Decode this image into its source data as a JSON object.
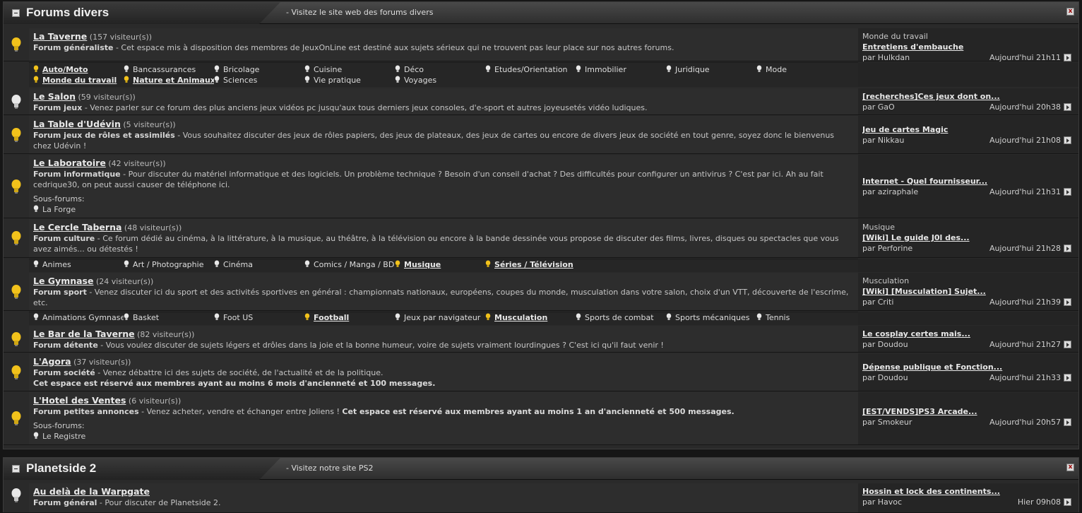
{
  "colors": {
    "bulb_on": "#f2c21b",
    "bulb_off": "#e8e8e8",
    "bg": "#2a2a2a"
  },
  "icons": {
    "bulb": "lightbulb-icon",
    "collapse": "minus-box-icon",
    "close": "close-box-icon",
    "goto": "arrow-right-box-icon"
  },
  "sections": [
    {
      "title": "Forums divers",
      "link": "- Visitez le site web des forums divers",
      "close": "x",
      "forums": [
        {
          "name": "La Taverne",
          "visitors": "(157 visiteur(s))",
          "type": "Forum généraliste",
          "desc": "- Cet espace mis à disposition des membres de JeuxOnLine est destiné aux sujets sérieux qui ne trouvent pas leur place sur nos autres forums.",
          "bold_note": "",
          "lit": true,
          "last": {
            "category": "Monde du travail",
            "topic": "Entretiens d'embauche",
            "by": "par Hulkdan",
            "time": "Aujourd'hui 21h11"
          },
          "subforums": [
            {
              "label": "Auto/Moto",
              "lit": true,
              "bold": true
            },
            {
              "label": "Bancassurances",
              "lit": false,
              "bold": false
            },
            {
              "label": "Bricolage",
              "lit": false,
              "bold": false
            },
            {
              "label": "Cuisine",
              "lit": false,
              "bold": false
            },
            {
              "label": "Déco",
              "lit": false,
              "bold": false
            },
            {
              "label": "Etudes/Orientation",
              "lit": false,
              "bold": false
            },
            {
              "label": "Immobilier",
              "lit": false,
              "bold": false
            },
            {
              "label": "Juridique",
              "lit": false,
              "bold": false
            },
            {
              "label": "Mode",
              "lit": false,
              "bold": false
            },
            {
              "label": "Monde du travail",
              "lit": true,
              "bold": true
            },
            {
              "label": "Nature et Animaux",
              "lit": true,
              "bold": true
            },
            {
              "label": "Sciences",
              "lit": false,
              "bold": false
            },
            {
              "label": "Vie pratique",
              "lit": false,
              "bold": false
            },
            {
              "label": "Voyages",
              "lit": false,
              "bold": false
            }
          ]
        },
        {
          "name": "Le Salon",
          "visitors": "(59 visiteur(s))",
          "type": "Forum jeux",
          "desc": "- Venez parler sur ce forum des plus anciens jeux vidéos pc jusqu'aux tous derniers jeux consoles, d'e-sport et autres joyeusetés vidéo ludiques.",
          "bold_note": "",
          "lit": false,
          "last": {
            "category": "",
            "topic": "[recherches]Ces jeux dont on...",
            "by": "par GaO",
            "time": "Aujourd'hui 20h38"
          }
        },
        {
          "name": "La Table d'Udévin",
          "visitors": "(5 visiteur(s))",
          "type": "Forum jeux de rôles et assimilés",
          "desc": "- Vous souhaitez discuter des jeux de rôles papiers, des jeux de plateaux, des jeux de cartes ou encore de divers jeux de société en tout genre, soyez donc le bienvenus chez Udévin !",
          "bold_note": "",
          "lit": true,
          "last": {
            "category": "",
            "topic": "Jeu de cartes Magic",
            "by": "par Nikkau",
            "time": "Aujourd'hui 21h08"
          }
        },
        {
          "name": "Le Laboratoire",
          "visitors": "(42 visiteur(s))",
          "type": "Forum informatique",
          "desc": "- Pour discuter du matériel informatique et des logiciels. Un problème technique ? Besoin d'un conseil d'achat ? Des difficultés pour configurer un antivirus ? C'est par ici. Ah au fait cedrique30, on peut aussi causer de téléphone ici.",
          "bold_note": "",
          "lit": true,
          "sous_label": "Sous-forums:",
          "sous": "La Forge",
          "last": {
            "category": "",
            "topic": "Internet - Quel fournisseur...",
            "by": "par aziraphale",
            "time": "Aujourd'hui 21h31"
          }
        },
        {
          "name": "Le Cercle Taberna",
          "visitors": "(48 visiteur(s))",
          "type": "Forum culture",
          "desc": "- Ce forum dédié au cinéma, à la littérature, à la musique, au théâtre, à la télévision ou encore à la bande dessinée vous propose de discuter des films, livres, disques ou spectacles que vous avez aimés... ou détestés !",
          "bold_note": "",
          "lit": true,
          "last": {
            "category": "Musique",
            "topic": "[Wiki] Le guide J0l des...",
            "by": "par Perforine",
            "time": "Aujourd'hui 21h28"
          },
          "subforums": [
            {
              "label": "Animes",
              "lit": false,
              "bold": false
            },
            {
              "label": "Art / Photographie",
              "lit": false,
              "bold": false
            },
            {
              "label": "Cinéma",
              "lit": false,
              "bold": false
            },
            {
              "label": "Comics / Manga / BD",
              "lit": false,
              "bold": false
            },
            {
              "label": "Musique",
              "lit": true,
              "bold": true
            },
            {
              "label": "Séries / Télévision",
              "lit": true,
              "bold": true
            }
          ]
        },
        {
          "name": "Le Gymnase",
          "visitors": "(24 visiteur(s))",
          "type": "Forum sport",
          "desc": "- Venez discuter ici du sport et des activités sportives en général : championnats nationaux, européens, coupes du monde, musculation dans votre salon, choix d'un VTT, découverte de l'escrime, etc.",
          "bold_note": "",
          "lit": true,
          "last": {
            "category": "Musculation",
            "topic": "[Wiki] [Musculation] Sujet...",
            "by": "par Criti",
            "time": "Aujourd'hui 21h39"
          },
          "subforums": [
            {
              "label": "Animations Gymnase",
              "lit": false,
              "bold": false
            },
            {
              "label": "Basket",
              "lit": false,
              "bold": false
            },
            {
              "label": "Foot US",
              "lit": false,
              "bold": false
            },
            {
              "label": "Football",
              "lit": true,
              "bold": true
            },
            {
              "label": "Jeux par navigateur",
              "lit": false,
              "bold": false
            },
            {
              "label": "Musculation",
              "lit": true,
              "bold": true
            },
            {
              "label": "Sports de combat",
              "lit": false,
              "bold": false
            },
            {
              "label": "Sports mécaniques",
              "lit": false,
              "bold": false
            },
            {
              "label": "Tennis",
              "lit": false,
              "bold": false
            }
          ]
        },
        {
          "name": "Le Bar de la Taverne",
          "visitors": "(82 visiteur(s))",
          "type": "Forum détente",
          "desc": "- Vous voulez discuter de sujets légers et drôles dans la joie et la bonne humeur, voire de sujets vraiment lourdingues ? C'est ici qu'il faut venir !",
          "bold_note": "",
          "lit": true,
          "last": {
            "category": "",
            "topic": "Le cosplay certes mais...",
            "by": "par Doudou",
            "time": "Aujourd'hui 21h27"
          }
        },
        {
          "name": "L'Agora",
          "visitors": "(37 visiteur(s))",
          "type": "Forum société",
          "desc": "- Venez débattre ici des sujets de société, de l'actualité et de la politique.",
          "bold_note": "Cet espace est réservé aux membres ayant au moins 6 mois d'ancienneté et 100 messages.",
          "lit": true,
          "last": {
            "category": "",
            "topic": "Dépense publique et Fonction...",
            "by": "par Doudou",
            "time": "Aujourd'hui 21h33"
          }
        },
        {
          "name": "L'Hotel des Ventes",
          "visitors": "(6 visiteur(s))",
          "type": "Forum petites annonces",
          "desc": "- Venez acheter, vendre et échanger entre Joliens !",
          "bold_note": "Cet espace est réservé aux membres ayant au moins 1 an d'ancienneté et 500 messages.",
          "lit": true,
          "sous_label": "Sous-forums:",
          "sous": "Le Registre",
          "last": {
            "category": "",
            "topic": "[EST/VENDS]PS3 Arcade...",
            "by": "par Smokeur",
            "time": "Aujourd'hui 20h57"
          }
        }
      ]
    },
    {
      "title": "Planetside 2",
      "link": "- Visitez notre site PS2",
      "close": "x",
      "forums": [
        {
          "name": "Au delà de la Warpgate",
          "visitors": "",
          "type": "Forum général",
          "desc": "- Pour discuter de Planetside 2.",
          "bold_note": "",
          "lit": false,
          "last": {
            "category": "",
            "topic": "Hossin et lock des continents...",
            "by": "par Havoc",
            "time": "Hier 09h08"
          }
        }
      ]
    }
  ]
}
